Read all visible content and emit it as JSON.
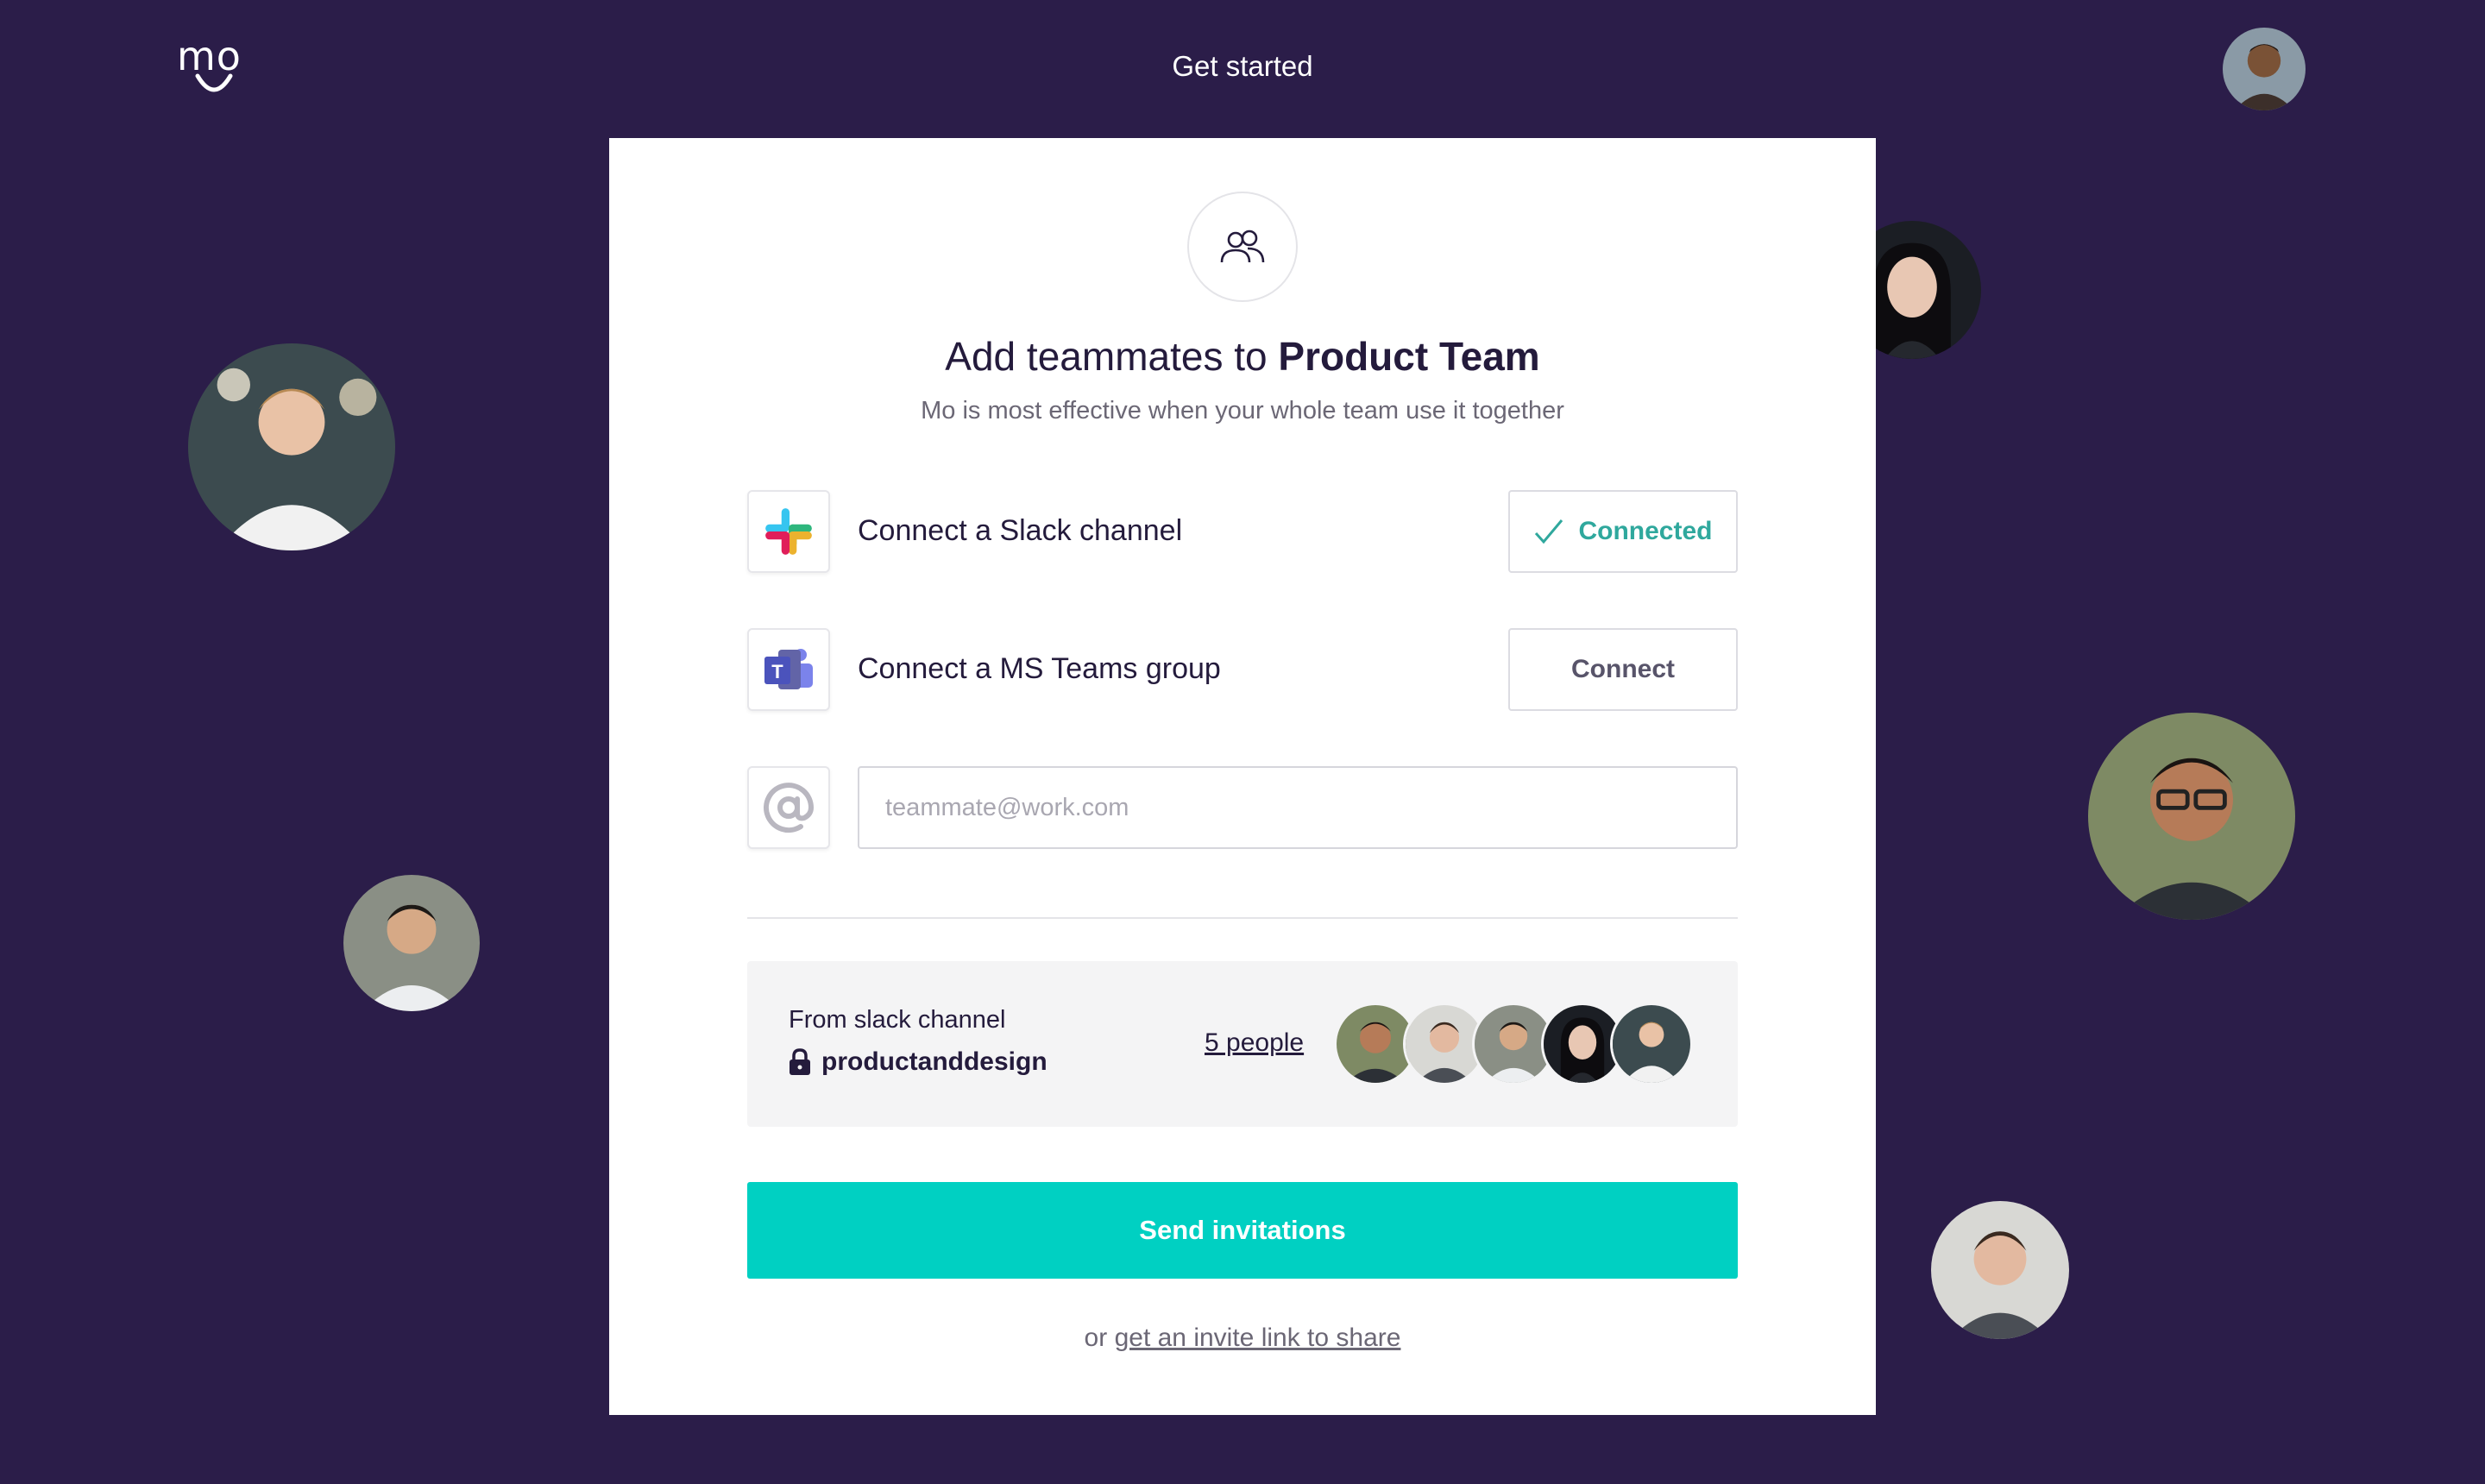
{
  "header": {
    "logo_text": "mo",
    "title": "Get started"
  },
  "card": {
    "heading_prefix": "Add teammates to",
    "heading_team": "Product Team",
    "subtitle": "Mo is most effective when your whole team use it together",
    "slack": {
      "label": "Connect a Slack channel",
      "button": "Connected",
      "icon": "slack-icon"
    },
    "teams": {
      "label": "Connect a MS Teams group",
      "button": "Connect",
      "icon": "ms-teams-icon"
    },
    "email": {
      "placeholder": "teammate@work.com",
      "icon": "at-sign-icon"
    },
    "channel_box": {
      "from_label": "From slack channel",
      "channel_name": "productanddesign",
      "people_link": "5 people"
    },
    "send_button": "Send invitations",
    "invite_prefix": "or",
    "invite_link": "get an invite link to share"
  },
  "colors": {
    "background": "#2b1d49",
    "accent": "#00d0c2",
    "connected": "#2fa89d"
  }
}
